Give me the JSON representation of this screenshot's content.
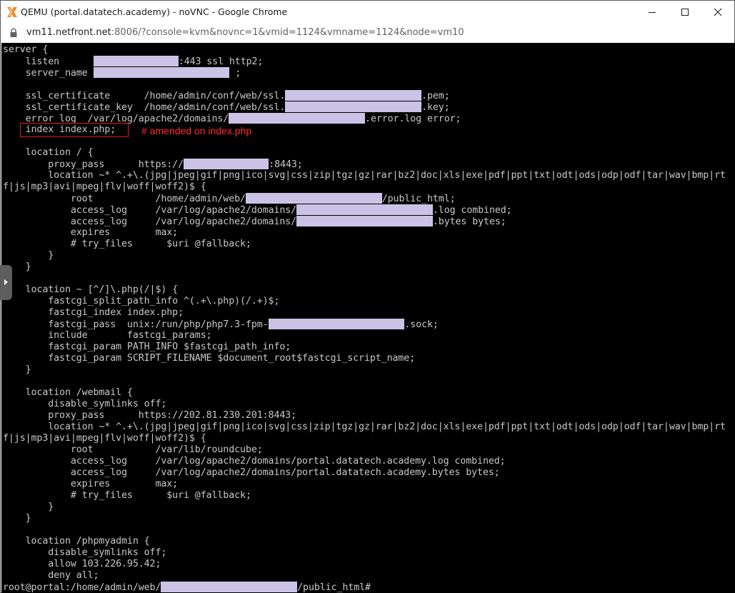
{
  "window": {
    "title": "QEMU (portal.datatech.academy) - noVNC - Google Chrome",
    "icon": "qemu-x-icon",
    "controls": [
      "minimize-icon",
      "maximize-icon",
      "close-icon"
    ]
  },
  "address": {
    "host": "vm11.netfront.net",
    "rest": ":8006/?console=kvm&novnc=1&vmid=1124&vmname=1124&node=vm10"
  },
  "annotation": {
    "text": "# amended on index.php",
    "color": "#ff2a2a"
  },
  "colors": {
    "terminal_bg": "#000000",
    "terminal_fg": "#c8c8c8",
    "redaction": "#cbc3e6"
  },
  "terminal": {
    "lines": [
      [
        {
          "t": "server {"
        }
      ],
      [
        {
          "t": "    listen      "
        },
        {
          "r": 15
        },
        {
          "t": ":443 ssl http2;"
        }
      ],
      [
        {
          "t": "    server_name "
        },
        {
          "r": 24
        },
        {
          "t": " ;"
        }
      ],
      [
        {
          "t": ""
        }
      ],
      [
        {
          "t": "    ssl_certificate      /home/admin/conf/web/ssl."
        },
        {
          "r": 24
        },
        {
          "t": ".pem;"
        }
      ],
      [
        {
          "t": "    ssl_certificate_key  /home/admin/conf/web/ssl."
        },
        {
          "r": 24
        },
        {
          "t": ".key;"
        }
      ],
      [
        {
          "t": "    error_log  /var/log/apache2/domains/"
        },
        {
          "r": 24
        },
        {
          "t": ".error.log error;"
        }
      ],
      [
        {
          "t": "    index index.php;"
        }
      ],
      [
        {
          "t": ""
        }
      ],
      [
        {
          "t": "    location / {"
        }
      ],
      [
        {
          "t": "        proxy_pass      https://"
        },
        {
          "r": 15
        },
        {
          "t": ":8443;"
        }
      ],
      [
        {
          "t": "        location ~* ^.+\\.(jpg|jpeg|gif|png|ico|svg|css|zip|tgz|gz|rar|bz2|doc|xls|exe|pdf|ppt|txt|odt|ods|odp|odf|tar|wav|bmp|rt"
        }
      ],
      [
        {
          "t": "f|js|mp3|avi|mpeg|flv|woff|woff2)$ {"
        }
      ],
      [
        {
          "t": "            root           /home/admin/web/"
        },
        {
          "r": 24
        },
        {
          "t": "/public_html;"
        }
      ],
      [
        {
          "t": "            access_log     /var/log/apache2/domains/"
        },
        {
          "r": 24
        },
        {
          "t": ".log combined;"
        }
      ],
      [
        {
          "t": "            access_log     /var/log/apache2/domains/"
        },
        {
          "r": 24
        },
        {
          "t": ".bytes bytes;"
        }
      ],
      [
        {
          "t": "            expires        max;"
        }
      ],
      [
        {
          "t": "            # try_files      $uri @fallback;"
        }
      ],
      [
        {
          "t": "        }"
        }
      ],
      [
        {
          "t": "    }"
        }
      ],
      [
        {
          "t": ""
        }
      ],
      [
        {
          "t": "    location ~ [^/]\\.php(/|$) {"
        }
      ],
      [
        {
          "t": "        fastcgi_split_path_info ^(.+\\.php)(/.+)$;"
        }
      ],
      [
        {
          "t": "        fastcgi_index index.php;"
        }
      ],
      [
        {
          "t": "        fastcgi_pass  unix:/run/php/php7.3-fpm-"
        },
        {
          "r": 24
        },
        {
          "t": ".sock;"
        }
      ],
      [
        {
          "t": "        include       fastcgi_params;"
        }
      ],
      [
        {
          "t": "        fastcgi_param PATH_INFO $fastcgi_path_info;"
        }
      ],
      [
        {
          "t": "        fastcgi_param SCRIPT_FILENAME $document_root$fastcgi_script_name;"
        }
      ],
      [
        {
          "t": "    }"
        }
      ],
      [
        {
          "t": ""
        }
      ],
      [
        {
          "t": "    location /webmail {"
        }
      ],
      [
        {
          "t": "        disable_symlinks off;"
        }
      ],
      [
        {
          "t": "        proxy_pass      https://202.81.230.201:8443;"
        }
      ],
      [
        {
          "t": "        location ~* ^.+\\.(jpg|jpeg|gif|png|ico|svg|css|zip|tgz|gz|rar|bz2|doc|xls|exe|pdf|ppt|txt|odt|ods|odp|odf|tar|wav|bmp|rt"
        }
      ],
      [
        {
          "t": "f|js|mp3|avi|mpeg|flv|woff|woff2)$ {"
        }
      ],
      [
        {
          "t": "            root           /var/lib/roundcube;"
        }
      ],
      [
        {
          "t": "            access_log     /var/log/apache2/domains/portal.datatech.academy.log combined;"
        }
      ],
      [
        {
          "t": "            access_log     /var/log/apache2/domains/portal.datatech.academy.bytes bytes;"
        }
      ],
      [
        {
          "t": "            expires        max;"
        }
      ],
      [
        {
          "t": "            # try_files      $uri @fallback;"
        }
      ],
      [
        {
          "t": "        }"
        }
      ],
      [
        {
          "t": "    }"
        }
      ],
      [
        {
          "t": ""
        }
      ],
      [
        {
          "t": "    location /phpmyadmin {"
        }
      ],
      [
        {
          "t": "        disable_symlinks off;"
        }
      ],
      [
        {
          "t": "        allow 103.226.95.42;"
        }
      ],
      [
        {
          "t": "        deny all;"
        }
      ],
      [
        {
          "t": "root@portal:/home/admin/web/"
        },
        {
          "r": 24
        },
        {
          "t": "/public_html#"
        }
      ]
    ]
  }
}
